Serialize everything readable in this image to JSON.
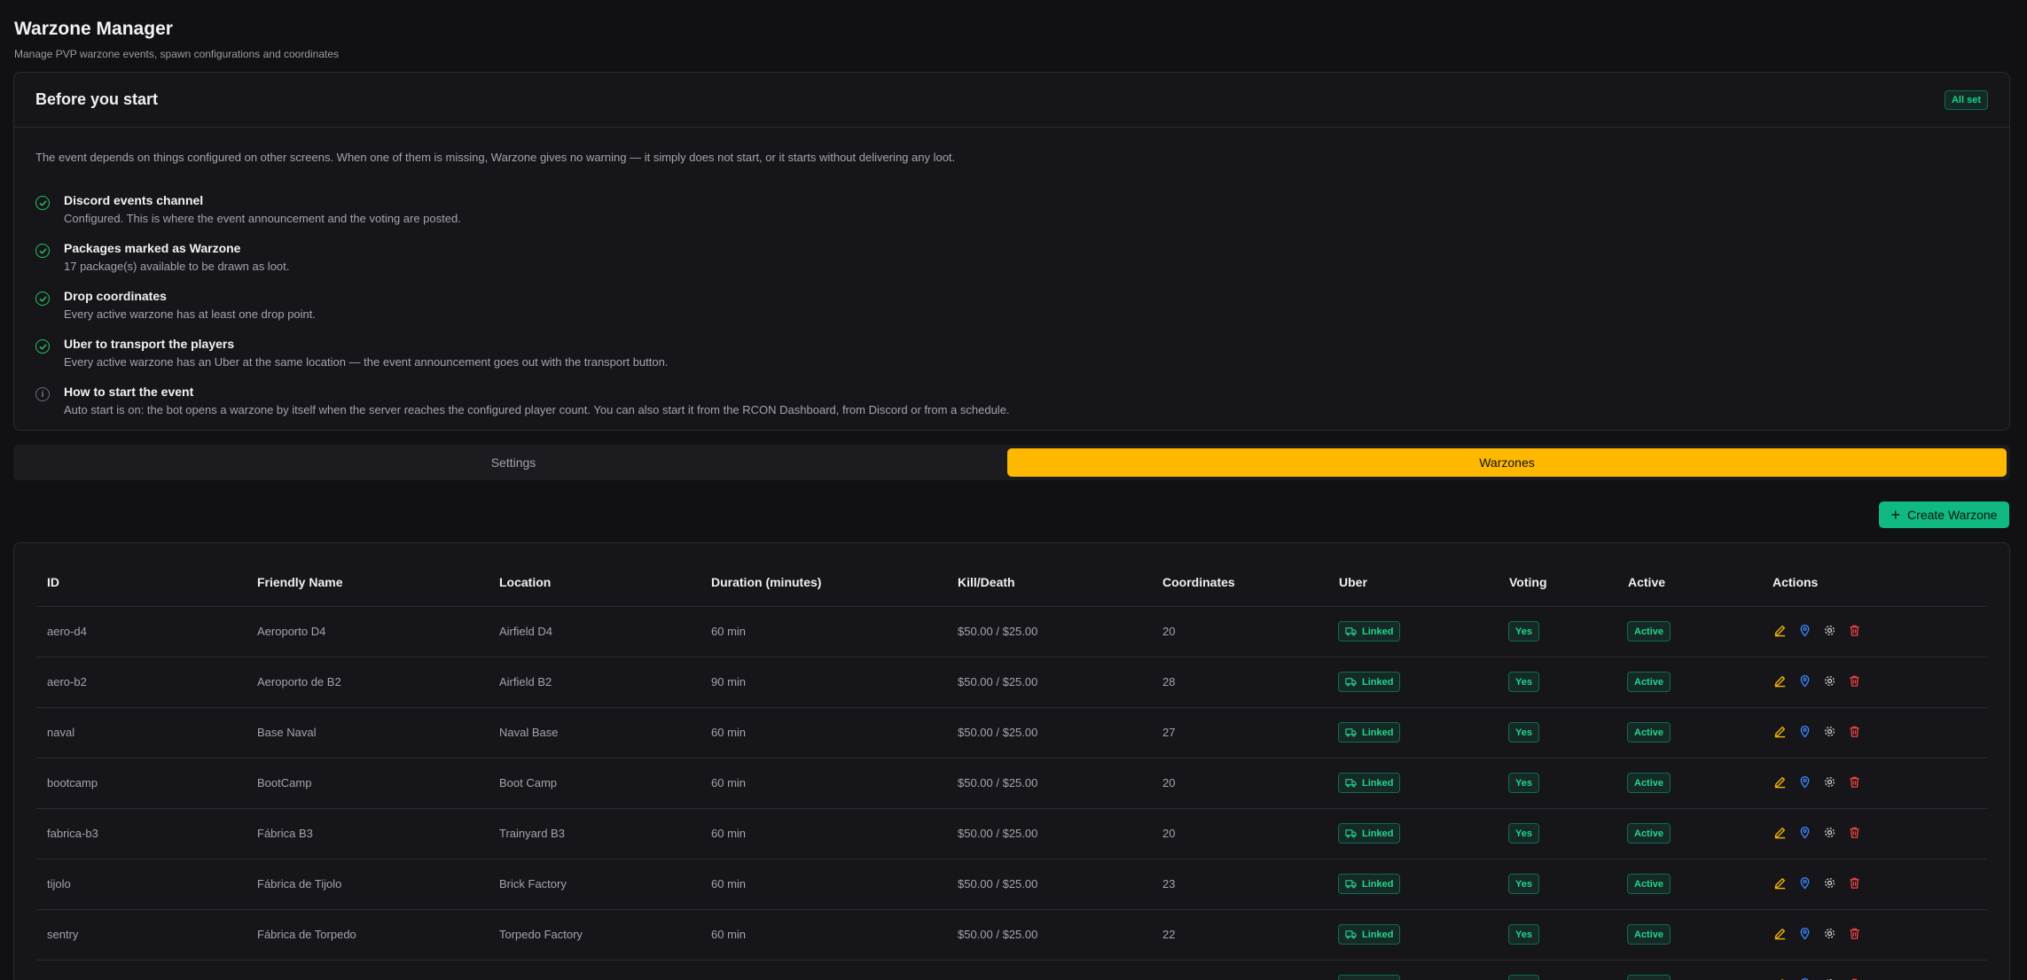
{
  "header": {
    "title": "Warzone Manager",
    "subtitle": "Manage PVP warzone events, spawn configurations and coordinates"
  },
  "checklist": {
    "title": "Before you start",
    "status_badge": "All set",
    "intro": "The event depends on things configured on other screens. When one of them is missing, Warzone gives no warning — it simply does not start, or it starts without delivering any loot.",
    "items": [
      {
        "title": "Discord events channel",
        "desc": "Configured. This is where the event announcement and the voting are posted.",
        "icon": "check-circle-icon"
      },
      {
        "title": "Packages marked as Warzone",
        "desc": "17 package(s) available to be drawn as loot.",
        "icon": "check-circle-icon"
      },
      {
        "title": "Drop coordinates",
        "desc": "Every active warzone has at least one drop point.",
        "icon": "check-circle-icon"
      },
      {
        "title": "Uber to transport the players",
        "desc": "Every active warzone has an Uber at the same location — the event announcement goes out with the transport button.",
        "icon": "check-circle-icon"
      },
      {
        "title": "How to start the event",
        "desc": "Auto start is on: the bot opens a warzone by itself when the server reaches the configured player count. You can also start it from the RCON Dashboard, from Discord or from a schedule.",
        "icon": "info-icon"
      }
    ]
  },
  "tabs": [
    {
      "label": "Settings",
      "active": false
    },
    {
      "label": "Warzones",
      "active": true
    }
  ],
  "create_button": {
    "label": "Create Warzone",
    "icon": "plus-icon"
  },
  "table": {
    "columns": [
      "ID",
      "Friendly Name",
      "Location",
      "Duration (minutes)",
      "Kill/Death",
      "Coordinates",
      "Uber",
      "Voting",
      "Active",
      "Actions"
    ],
    "rows": [
      {
        "id": "aero-d4",
        "name": "Aeroporto D4",
        "location": "Airfield D4",
        "duration": "60 min",
        "kd": "$50.00 / $25.00",
        "coords": "20",
        "uber": "Linked",
        "voting": "Yes",
        "active": "Active"
      },
      {
        "id": "aero-b2",
        "name": "Aeroporto de B2",
        "location": "Airfield B2",
        "duration": "90 min",
        "kd": "$50.00 / $25.00",
        "coords": "28",
        "uber": "Linked",
        "voting": "Yes",
        "active": "Active"
      },
      {
        "id": "naval",
        "name": "Base Naval",
        "location": "Naval Base",
        "duration": "60 min",
        "kd": "$50.00 / $25.00",
        "coords": "27",
        "uber": "Linked",
        "voting": "Yes",
        "active": "Active"
      },
      {
        "id": "bootcamp",
        "name": "BootCamp",
        "location": "Boot Camp",
        "duration": "60 min",
        "kd": "$50.00 / $25.00",
        "coords": "20",
        "uber": "Linked",
        "voting": "Yes",
        "active": "Active"
      },
      {
        "id": "fabrica-b3",
        "name": "Fábrica B3",
        "location": "Trainyard B3",
        "duration": "60 min",
        "kd": "$50.00 / $25.00",
        "coords": "20",
        "uber": "Linked",
        "voting": "Yes",
        "active": "Active"
      },
      {
        "id": "tijolo",
        "name": "Fábrica de Tijolo",
        "location": "Brick Factory",
        "duration": "60 min",
        "kd": "$50.00 / $25.00",
        "coords": "23",
        "uber": "Linked",
        "voting": "Yes",
        "active": "Active"
      },
      {
        "id": "sentry",
        "name": "Fábrica de Torpedo",
        "location": "Torpedo Factory",
        "duration": "60 min",
        "kd": "$50.00 / $25.00",
        "coords": "22",
        "uber": "Linked",
        "voting": "Yes",
        "active": "Active"
      },
      {
        "id": "",
        "name": "",
        "location": "",
        "duration": "",
        "kd": "",
        "coords": "",
        "uber": "Linked",
        "voting": "Yes",
        "active": "Active"
      }
    ],
    "action_icons": [
      "edit-icon",
      "map-pin-icon",
      "gear-icon",
      "trash-icon"
    ]
  },
  "colors": {
    "accent": "#ffb800",
    "success": "#10b981",
    "edit": "#f5b301",
    "pin": "#3b82f6",
    "delete": "#ef4444"
  }
}
